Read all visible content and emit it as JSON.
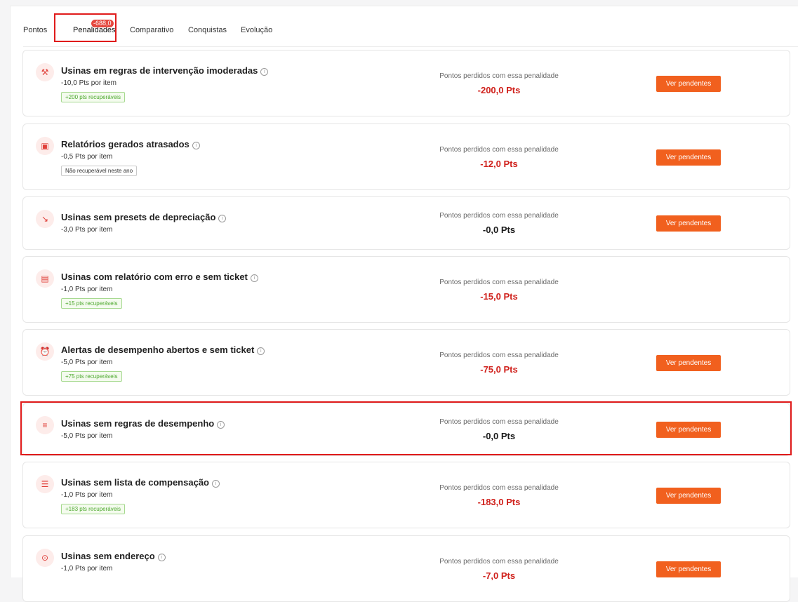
{
  "tabs": [
    {
      "label": "Pontos"
    },
    {
      "label": "Penalidades",
      "badge": "-688,0"
    },
    {
      "label": "Comparativo"
    },
    {
      "label": "Conquistas"
    },
    {
      "label": "Evolução"
    }
  ],
  "lost_label": "Pontos perdidos com essa penalidade",
  "button_label": "Ver pendentes",
  "penalties": [
    {
      "title": "Usinas em regras de intervenção imoderadas",
      "per_item": "-10,0 Pts por item",
      "tag": "+200 pts recuperáveis",
      "tag_type": "green",
      "lost": "-200,0 Pts",
      "lost_color": "red",
      "icon": "gavel-icon"
    },
    {
      "title": "Relatórios gerados atrasados",
      "per_item": "-0,5 Pts por item",
      "tag": "Não recuperável neste ano",
      "tag_type": "gray",
      "lost": "-12,0 Pts",
      "lost_color": "red",
      "icon": "calendar-x-icon"
    },
    {
      "title": "Usinas sem presets de depreciação",
      "per_item": "-3,0 Pts por item",
      "tag": "",
      "lost": "-0,0 Pts",
      "lost_color": "black",
      "icon": "trending-down-icon"
    },
    {
      "title": "Usinas com relatório com erro e sem ticket",
      "per_item": "-1,0 Pts por item",
      "tag": "+15 pts recuperáveis",
      "tag_type": "green",
      "lost": "-15,0 Pts",
      "lost_color": "red",
      "icon": "clipboard-alert-icon"
    },
    {
      "title": "Alertas de desempenho abertos e sem ticket",
      "per_item": "-5,0 Pts por item",
      "tag": "+75 pts recuperáveis",
      "tag_type": "green",
      "lost": "-75,0 Pts",
      "lost_color": "red",
      "icon": "siren-icon"
    },
    {
      "title": "Usinas sem regras de desempenho",
      "per_item": "-5,0 Pts por item",
      "tag": "",
      "lost": "-0,0 Pts",
      "lost_color": "black",
      "icon": "list-x-icon"
    },
    {
      "title": "Usinas sem lista de compensação",
      "per_item": "-1,0 Pts por item",
      "tag": "+183 pts recuperáveis",
      "tag_type": "green",
      "lost": "-183,0 Pts",
      "lost_color": "red",
      "icon": "list-check-icon"
    },
    {
      "title": "Usinas sem endereço",
      "per_item": "-1,0 Pts por item",
      "tag": "",
      "lost": "-7,0 Pts",
      "lost_color": "red",
      "icon": "map-pin-icon"
    }
  ]
}
